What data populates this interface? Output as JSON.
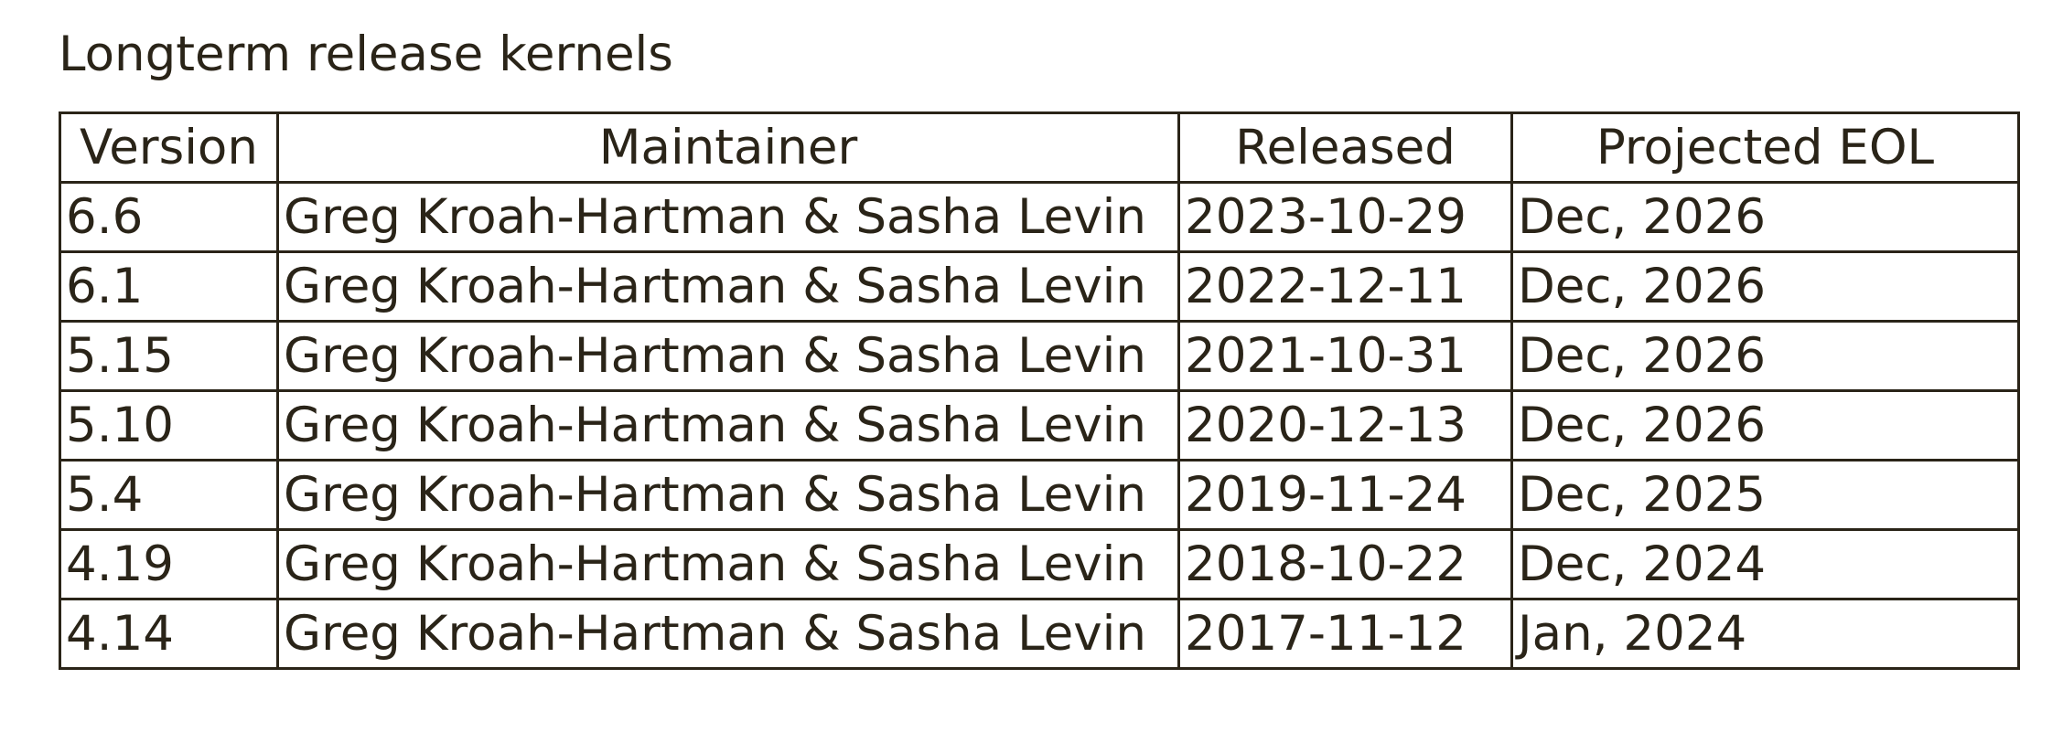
{
  "title": "Longterm release kernels",
  "table": {
    "headers": {
      "version": "Version",
      "maintainer": "Maintainer",
      "released": "Released",
      "eol": "Projected EOL"
    },
    "rows": [
      {
        "version": "6.6",
        "maintainer": "Greg Kroah-Hartman & Sasha Levin",
        "released": "2023-10-29",
        "eol": "Dec, 2026"
      },
      {
        "version": "6.1",
        "maintainer": "Greg Kroah-Hartman & Sasha Levin",
        "released": "2022-12-11",
        "eol": "Dec, 2026"
      },
      {
        "version": "5.15",
        "maintainer": "Greg Kroah-Hartman & Sasha Levin",
        "released": "2021-10-31",
        "eol": "Dec, 2026"
      },
      {
        "version": "5.10",
        "maintainer": "Greg Kroah-Hartman & Sasha Levin",
        "released": "2020-12-13",
        "eol": "Dec, 2026"
      },
      {
        "version": "5.4",
        "maintainer": "Greg Kroah-Hartman & Sasha Levin",
        "released": "2019-11-24",
        "eol": "Dec, 2025"
      },
      {
        "version": "4.19",
        "maintainer": "Greg Kroah-Hartman & Sasha Levin",
        "released": "2018-10-22",
        "eol": "Dec, 2024"
      },
      {
        "version": "4.14",
        "maintainer": "Greg Kroah-Hartman & Sasha Levin",
        "released": "2017-11-12",
        "eol": "Jan, 2024"
      }
    ]
  },
  "colors": {
    "text": "#2a2418",
    "border": "#2a2418",
    "background": "#ffffff"
  }
}
